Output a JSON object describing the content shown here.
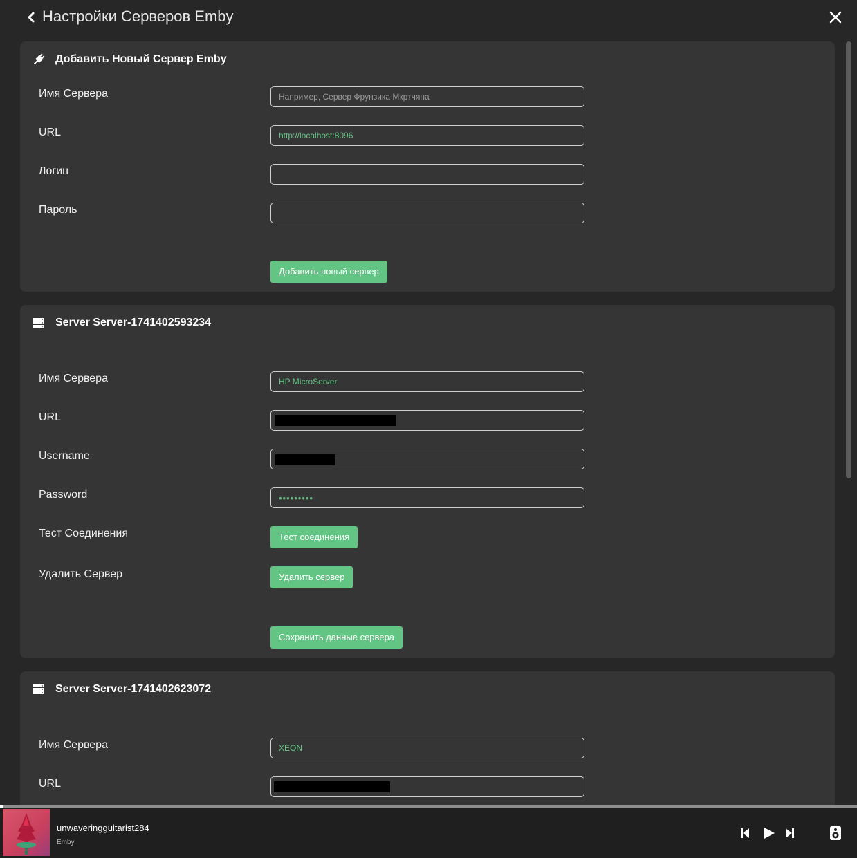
{
  "header": {
    "title": "Настройки Серверов Emby"
  },
  "add_server": {
    "title": "Добавить Новый Сервер Emby",
    "server_name_label": "Имя Сервера",
    "server_name_placeholder": "Например, Сервер Фрунзика Мкртчяна",
    "url_label": "URL",
    "url_value": "http://localhost:8096",
    "login_label": "Логин",
    "password_label": "Пароль",
    "add_button": "Добавить новый сервер"
  },
  "servers": [
    {
      "title": "Server Server-1741402593234",
      "server_name_label": "Имя Сервера",
      "server_name_value": "HP MicroServer",
      "url_label": "URL",
      "username_label": "Username",
      "password_label": "Password",
      "password_value": "•••••••••",
      "test_label": "Тест Соединения",
      "test_button": "Тест соединения",
      "delete_label": "Удалить Сервер",
      "delete_button": "Удалить сервер",
      "save_button": "Сохранить данные сервера"
    },
    {
      "title": "Server Server-1741402623072",
      "server_name_label": "Имя Сервера",
      "server_name_value": "XEON",
      "url_label": "URL"
    }
  ],
  "player": {
    "track_name": "unwaveringguitarist284",
    "source": "Emby",
    "progress": 0.004
  },
  "colors": {
    "accent": "#63c584",
    "background": "#272727",
    "card": "#353535"
  }
}
